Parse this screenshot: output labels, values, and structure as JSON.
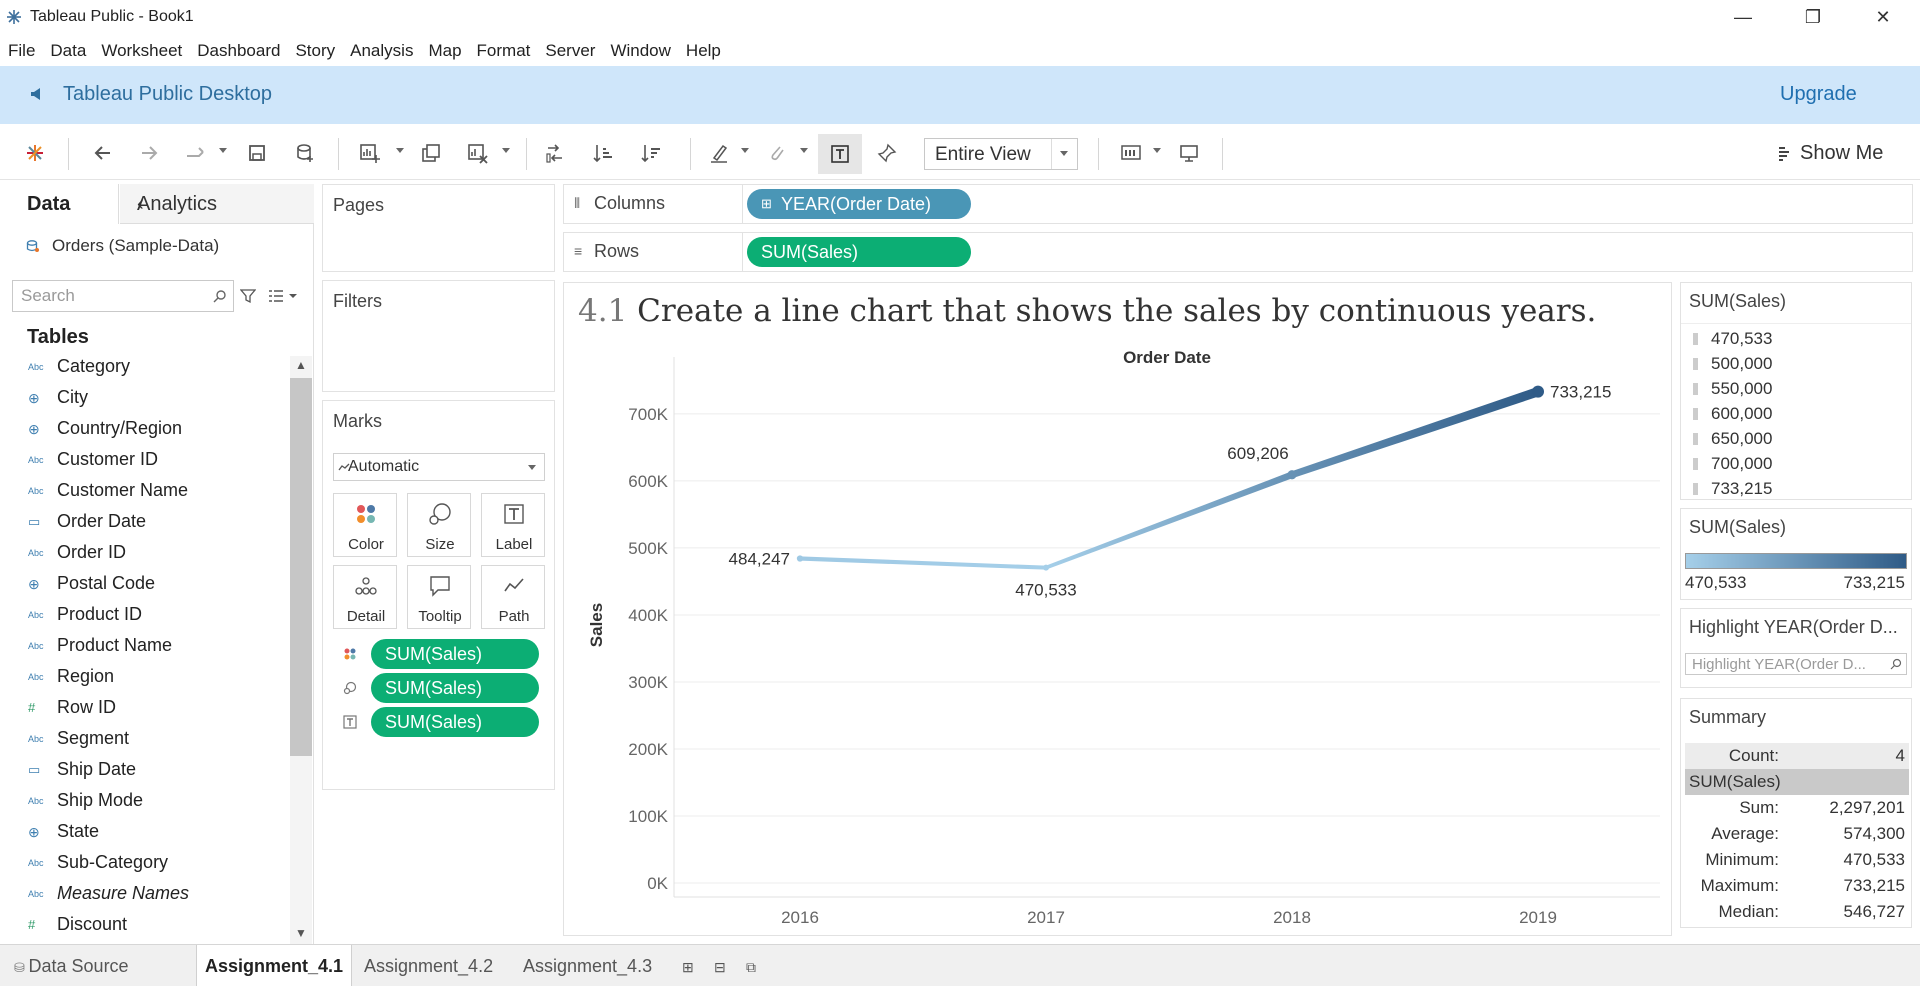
{
  "window": {
    "title": "Tableau Public - Book1",
    "minimize": "—",
    "restore": "❐",
    "close": "✕"
  },
  "menu": [
    "File",
    "Data",
    "Worksheet",
    "Dashboard",
    "Story",
    "Analysis",
    "Map",
    "Format",
    "Server",
    "Window",
    "Help"
  ],
  "banner": {
    "title": "Tableau Public Desktop",
    "upgrade": "Upgrade"
  },
  "toolbar": {
    "fit_select": "Entire View",
    "show_me": "Show Me"
  },
  "data_pane": {
    "tabs": [
      "Data",
      "Analytics"
    ],
    "datasource": "Orders (Sample-Data)",
    "search_placeholder": "Search",
    "tables_heading": "Tables",
    "fields": [
      {
        "name": "Category",
        "type": "Abc"
      },
      {
        "name": "City",
        "type": "geo"
      },
      {
        "name": "Country/Region",
        "type": "geo"
      },
      {
        "name": "Customer ID",
        "type": "Abc"
      },
      {
        "name": "Customer Name",
        "type": "Abc"
      },
      {
        "name": "Order Date",
        "type": "date"
      },
      {
        "name": "Order ID",
        "type": "Abc"
      },
      {
        "name": "Postal Code",
        "type": "geo"
      },
      {
        "name": "Product ID",
        "type": "Abc"
      },
      {
        "name": "Product Name",
        "type": "Abc"
      },
      {
        "name": "Region",
        "type": "Abc"
      },
      {
        "name": "Row ID",
        "type": "num"
      },
      {
        "name": "Segment",
        "type": "Abc"
      },
      {
        "name": "Ship Date",
        "type": "date"
      },
      {
        "name": "Ship Mode",
        "type": "Abc"
      },
      {
        "name": "State",
        "type": "geo"
      },
      {
        "name": "Sub-Category",
        "type": "Abc"
      },
      {
        "name": "Measure Names",
        "type": "Abc",
        "italic": true
      },
      {
        "name": "Discount",
        "type": "num"
      }
    ]
  },
  "cards": {
    "pages": "Pages",
    "filters": "Filters",
    "marks": "Marks",
    "mark_type": "Automatic",
    "mark_buttons": [
      "Color",
      "Size",
      "Label",
      "Detail",
      "Tooltip",
      "Path"
    ],
    "mark_pills": [
      "SUM(Sales)",
      "SUM(Sales)",
      "SUM(Sales)"
    ]
  },
  "shelves": {
    "columns_label": "Columns",
    "columns_pill": "YEAR(Order Date)",
    "rows_label": "Rows",
    "rows_pill": "SUM(Sales)"
  },
  "view": {
    "title_num": "4.1",
    "title_text": "Create a line chart that shows the sales by continuous years."
  },
  "chart_data": {
    "type": "line",
    "title": "4.1 Create a line chart that shows the sales by continuous years.",
    "xlabel": "Order Date",
    "ylabel": "Sales",
    "x": [
      "2016",
      "2017",
      "2018",
      "2019"
    ],
    "values": [
      484247,
      470533,
      609206,
      733215
    ],
    "data_labels": [
      "484,247",
      "470,533",
      "609,206",
      "733,215"
    ],
    "y_ticks": [
      "0K",
      "100K",
      "200K",
      "300K",
      "400K",
      "500K",
      "600K",
      "700K"
    ],
    "ylim": [
      0,
      770000
    ],
    "grid": true,
    "color_ramp": [
      "#a5cfe9",
      "#2f5b87"
    ]
  },
  "legends": {
    "size_title": "SUM(Sales)",
    "size_values": [
      "470,533",
      "500,000",
      "550,000",
      "600,000",
      "650,000",
      "700,000",
      "733,215"
    ],
    "color_title": "SUM(Sales)",
    "color_min": "470,533",
    "color_max": "733,215",
    "highlight_title": "Highlight YEAR(Order D...",
    "highlight_placeholder": "Highlight YEAR(Order D...",
    "summary_title": "Summary",
    "summary_count_label": "Count:",
    "summary_count": "4",
    "summary_measure": "SUM(Sales)",
    "summary_rows": [
      {
        "label": "Sum:",
        "value": "2,297,201"
      },
      {
        "label": "Average:",
        "value": "574,300"
      },
      {
        "label": "Minimum:",
        "value": "470,533"
      },
      {
        "label": "Maximum:",
        "value": "733,215"
      },
      {
        "label": "Median:",
        "value": "546,727"
      }
    ]
  },
  "sheets": {
    "datasource": "Data Source",
    "tabs": [
      "Assignment_4.1",
      "Assignment_4.2",
      "Assignment_4.3"
    ]
  }
}
